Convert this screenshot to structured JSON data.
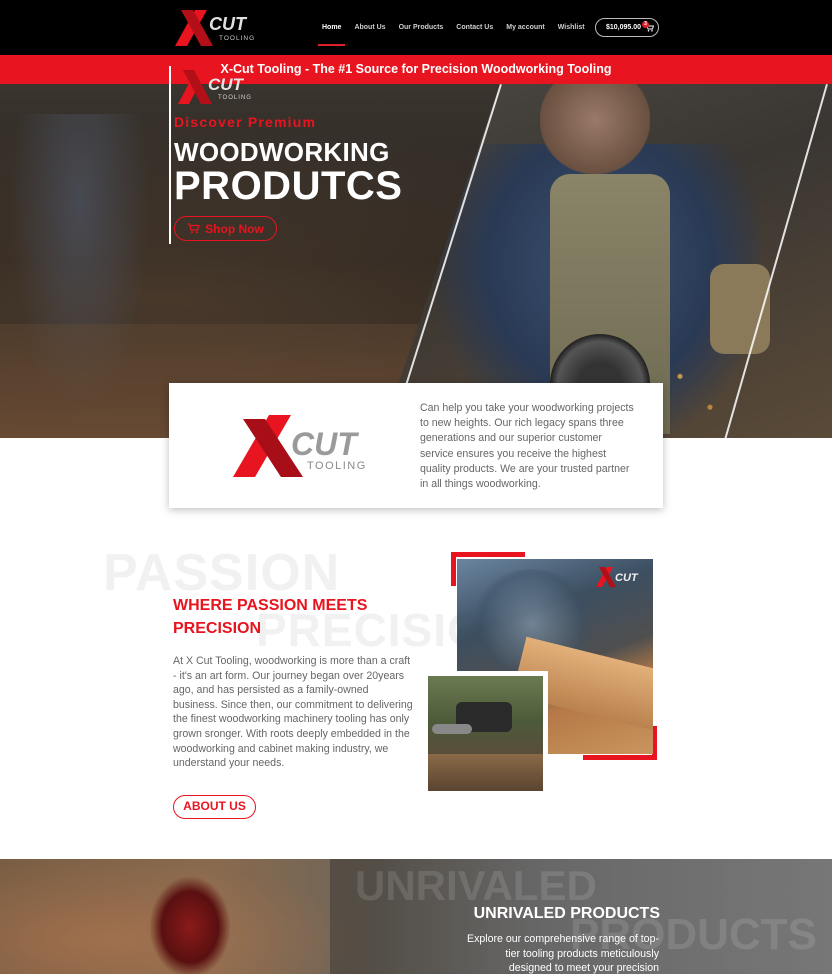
{
  "nav": {
    "logo_text": "CUT",
    "logo_sub": "TOOLING",
    "items": [
      {
        "label": "Home",
        "active": true
      },
      {
        "label": "About Us",
        "active": false
      },
      {
        "label": "Our Products",
        "active": false
      },
      {
        "label": "Contact Us",
        "active": false
      },
      {
        "label": "My account",
        "active": false
      },
      {
        "label": "Wishlist",
        "active": false
      }
    ],
    "cart_total": "$10,095.00",
    "cart_count": "3",
    "cart_icon": "cart-icon"
  },
  "banner": {
    "text": "X-Cut Tooling - The #1 Source for Precision Woodworking Tooling"
  },
  "hero": {
    "eyebrow": "Discover Premium",
    "title_line1": "WOODWORKING",
    "title_line2": "PRODUTCS",
    "button_label": "Shop Now",
    "button_icon": "cart-icon"
  },
  "intro": {
    "text": "Can help you take your woodworking projects to new heights. Our rich legacy spans three generations and our superior customer service ensures you receive the highest quality products. We are your trusted partner in all things woodworking."
  },
  "passion": {
    "ghost_word1": "PASSION",
    "ghost_word2": "PRECISION",
    "title": "WHERE PASSION MEETS PRECISION",
    "text": "At X Cut Tooling, woodworking is more than a craft - it's an art form. Our journey began over 20years ago, and has persisted as a family-owned business. Since then, our commitment to delivering the finest woodworking machinery tooling has only grown sronger. With roots deeply embedded in the woodworking and cabinet making industry, we understand your needs.",
    "button_label": "ABOUT US"
  },
  "products": {
    "ghost_word1": "UNRIVALED",
    "ghost_word2": "PRODUCTS",
    "title": "UNRIVALED PRODUCTS",
    "text": "Explore our comprehensive range of top-tier tooling products meticulously designed to meet your precision"
  },
  "colors": {
    "accent": "#e8141f",
    "nav_bg": "#000000"
  }
}
